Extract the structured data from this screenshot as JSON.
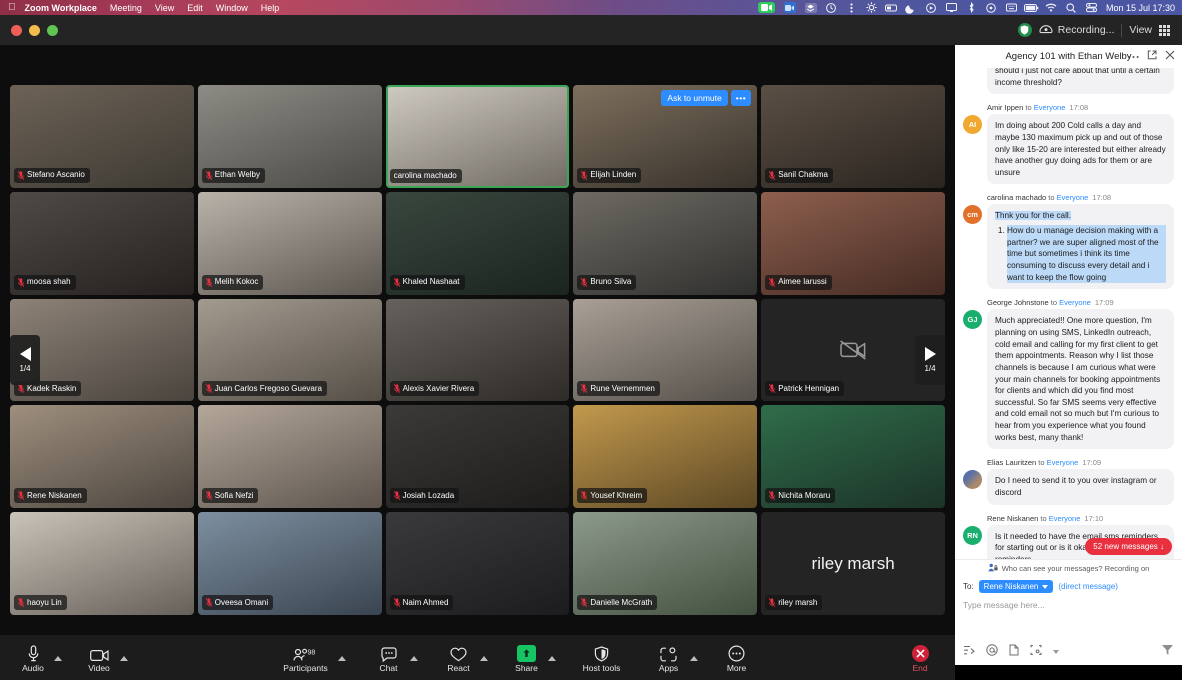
{
  "menubar": {
    "apple_icon": "apple-icon",
    "app_name": "Zoom Workplace",
    "items": [
      "Meeting",
      "View",
      "Edit",
      "Window",
      "Help"
    ],
    "status_icons": [
      "camera-active-icon",
      "zoom-app-icon",
      "dropbox-icon",
      "clock-icon",
      "kebab-icon",
      "settings-gear-icon",
      "battery-case-icon",
      "moon-icon",
      "record-circle-icon",
      "display-icon",
      "bluetooth-icon",
      "timemachine-icon",
      "keyboard-switch-icon",
      "battery-icon",
      "wifi-icon",
      "search-icon",
      "control-center-icon"
    ],
    "clock": "Mon 15 Jul  17:30"
  },
  "titlebar": {
    "shield_icon": "green-shield-icon",
    "recording_icon": "recording-cloud-icon",
    "recording_label": "Recording...",
    "view_label": "View",
    "view_icon": "grid-view-icon"
  },
  "stage": {
    "ask_to_unmute": "Ask to unmute",
    "more_dots": "•••",
    "pager_left": {
      "icon": "chevron-left-icon",
      "label": "1/4"
    },
    "pager_right": {
      "icon": "chevron-right-icon",
      "label": "1/4"
    },
    "participants": [
      {
        "name": "Stefano Ascanio",
        "muted": true,
        "active": false,
        "cam": true,
        "bg": "#6d6256",
        "bg2": "#3d3a33"
      },
      {
        "name": "Ethan Welby",
        "muted": true,
        "active": false,
        "cam": true,
        "bg": "#8d8b84",
        "bg2": "#4b4a46"
      },
      {
        "name": "carolina machado",
        "muted": false,
        "active": true,
        "cam": true,
        "bg": "#cfcac2",
        "bg2": "#6f6a62"
      },
      {
        "name": "Elijah Linden",
        "muted": true,
        "active": false,
        "cam": true,
        "bg": "#7d6f5d",
        "bg2": "#38322b",
        "ask_unmute": true
      },
      {
        "name": "Sanil Chakma",
        "muted": true,
        "active": false,
        "cam": true,
        "bg": "#5b4f45",
        "bg2": "#2a241f"
      },
      {
        "name": "moosa shah",
        "muted": true,
        "active": false,
        "cam": true,
        "bg": "#4d4a48",
        "bg2": "#26211f"
      },
      {
        "name": "Melih Kokoc",
        "muted": true,
        "active": false,
        "cam": true,
        "bg": "#b9b3aa",
        "bg2": "#5c5650"
      },
      {
        "name": "Khaled Nashaat",
        "muted": true,
        "active": false,
        "cam": true,
        "bg": "#39473e",
        "bg2": "#1b241f"
      },
      {
        "name": "Bruno Silva",
        "muted": true,
        "active": false,
        "cam": true,
        "bg": "#6e6a63",
        "bg2": "#30302e"
      },
      {
        "name": "Aimee Iarussi",
        "muted": true,
        "active": false,
        "cam": true,
        "bg": "#8d5f4e",
        "bg2": "#452b23"
      },
      {
        "name": "Kadek Raskin",
        "muted": true,
        "active": false,
        "cam": true,
        "bg": "#8d8277",
        "bg2": "#4a443e"
      },
      {
        "name": "Juan Carlos Fregoso Guevara",
        "muted": true,
        "active": false,
        "cam": true,
        "bg": "#a39b8f",
        "bg2": "#564f47"
      },
      {
        "name": "Alexis Xavier Rivera",
        "muted": true,
        "active": false,
        "cam": true,
        "bg": "#66615c",
        "bg2": "#2e2b28"
      },
      {
        "name": "Rune Vernemmen",
        "muted": true,
        "active": false,
        "cam": true,
        "bg": "#a9a096",
        "bg2": "#55504a"
      },
      {
        "name": "Patrick Hennigan",
        "muted": true,
        "active": false,
        "cam": false,
        "bg": "#242424",
        "bg2": "#242424"
      },
      {
        "name": "Rene Niskanen",
        "muted": true,
        "active": false,
        "cam": true,
        "bg": "#9e8f7e",
        "bg2": "#4d463f"
      },
      {
        "name": "Sofia Nefzi",
        "muted": true,
        "active": false,
        "cam": true,
        "bg": "#b4a79a",
        "bg2": "#5d554e"
      },
      {
        "name": "Josiah Lozada",
        "muted": true,
        "active": false,
        "cam": true,
        "bg": "#3b3a38",
        "bg2": "#1d1c1b"
      },
      {
        "name": "Yousef Khreim",
        "muted": true,
        "active": false,
        "cam": true,
        "bg": "#c2994d",
        "bg2": "#5c4824"
      },
      {
        "name": "Nichita Moraru",
        "muted": true,
        "active": false,
        "cam": true,
        "bg": "#2f6d4a",
        "bg2": "#1c3328"
      },
      {
        "name": "haoyu Lin",
        "muted": true,
        "active": false,
        "cam": true,
        "bg": "#c9c3b8",
        "bg2": "#66605a"
      },
      {
        "name": "Oveesa Omani",
        "muted": true,
        "active": false,
        "cam": true,
        "bg": "#7d8fa0",
        "bg2": "#3a4450"
      },
      {
        "name": "Naim Ahmed",
        "muted": true,
        "active": false,
        "cam": true,
        "bg": "#3a3a3c",
        "bg2": "#1c1c1e"
      },
      {
        "name": "Danielle McGrath",
        "muted": true,
        "active": false,
        "cam": true,
        "bg": "#8c9a8c",
        "bg2": "#44503f"
      },
      {
        "name": "riley marsh",
        "muted": true,
        "active": false,
        "cam": false,
        "bg": "#242424",
        "bg2": "#242424",
        "display_name": "riley marsh"
      }
    ]
  },
  "toolbar": {
    "buttons": [
      {
        "label": "Audio",
        "icon": "microphone-icon",
        "caret": true
      },
      {
        "label": "Video",
        "icon": "camera-icon",
        "caret": true
      },
      {
        "label": "Participants",
        "icon": "participants-icon",
        "caret": true,
        "count": "98"
      },
      {
        "label": "Chat",
        "icon": "chat-icon",
        "caret": true
      },
      {
        "label": "React",
        "icon": "heart-icon",
        "caret": false
      },
      {
        "label": "Share",
        "icon": "share-screen-icon",
        "caret": true
      },
      {
        "label": "Host tools",
        "icon": "shield-icon",
        "caret": false
      },
      {
        "label": "Apps",
        "icon": "apps-icon",
        "caret": true
      },
      {
        "label": "More",
        "icon": "more-dots-icon",
        "caret": false
      }
    ],
    "end_label": "End",
    "end_icon": "end-call-icon"
  },
  "chat": {
    "title": "Agency 101 with Ethan Welby",
    "actions": [
      "more-options-icon",
      "popout-icon",
      "close-icon"
    ],
    "messages": [
      {
        "id": "m0",
        "continuation": true,
        "avatar_type": "none",
        "text": "should i just not care about that until a certain income threshold?"
      },
      {
        "id": "m1",
        "sender": "Amir Ippen",
        "to_label": "to",
        "recipient": "Everyone",
        "time": "17:08",
        "avatar_initials": "AI",
        "avatar_color": "#f0a830",
        "text": "Im doing about 200 Cold calls a day and maybe 130 maximum pick up and out of those only like 15-20 are interested but either already have another guy doing ads for them or are unsure"
      },
      {
        "id": "m2",
        "sender": "carolina machado",
        "to_label": "to",
        "recipient": "Everyone",
        "time": "17:08",
        "avatar_initials": "cm",
        "avatar_color": "#e0702a",
        "highlighted": true,
        "text": "Thnk you for the call.",
        "list": [
          "How do u manage decision making with a partner? we are super aligned most of the time but sometimes i think its time consuming to discuss every detail and i want to keep the flow going"
        ]
      },
      {
        "id": "m3",
        "sender": "George Johnstone",
        "to_label": "to",
        "recipient": "Everyone",
        "time": "17:09",
        "avatar_initials": "GJ",
        "avatar_color": "#1aaf6e",
        "text": "Much appreciated!! One more question, I'm planning on using SMS, LinkedIn outreach, cold email and calling for my first client to get them appointments. Reason why I list those channels is because I am curious what were your main channels for booking appointments for clients and which did you find most successful. So far SMS seems very effective and cold email not so much but I'm curious to hear from you experience what you found works best, many thank!"
      },
      {
        "id": "m4",
        "sender": "Elias Lauritzen",
        "to_label": "to",
        "recipient": "Everyone",
        "time": "17:09",
        "avatar_initials": "",
        "avatar_photo": true,
        "text": "Do I need to send it to you over instagram or discord"
      },
      {
        "id": "m5",
        "sender": "Rene Niskanen",
        "to_label": "to",
        "recipient": "Everyone",
        "time": "17:10",
        "avatar_initials": "RN",
        "avatar_color": "#1aaf6e",
        "text": "Is it needed to have the email sms reminders for starting out or is it okay with just email reminders"
      }
    ],
    "new_messages_badge": "52 new messages ↓",
    "privacy_notice": "Who can see your messages? Recording on",
    "privacy_icon": "people-lock-icon",
    "to_label": "To:",
    "to_recipient": "Rene Niskanen",
    "direct_message_note": "(direct message)",
    "input_placeholder": "Type message here...",
    "tool_icons": [
      "format-text-icon",
      "mention-icon",
      "file-icon",
      "screenshot-icon",
      "emoji-caret-icon"
    ],
    "send_icon": "send-icon"
  },
  "colors": {
    "accent_blue": "#2d8cff",
    "alert_red": "#e8303f",
    "active_green": "#3aa655",
    "share_green": "#16c464"
  }
}
